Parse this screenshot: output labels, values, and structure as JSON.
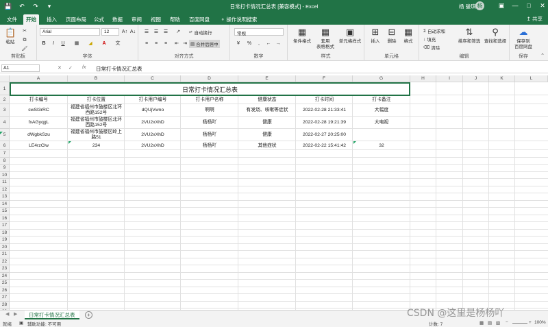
{
  "titlebar": {
    "title": "日常打卡情况汇总表 [兼容模式] - Excel",
    "user": "杨 骏琪",
    "avatar_initial": "杨"
  },
  "tabs": [
    "文件",
    "开始",
    "插入",
    "页面布局",
    "公式",
    "数据",
    "审阅",
    "视图",
    "帮助",
    "百度网盘",
    "操作说明搜索"
  ],
  "share_label": "共享",
  "ribbon": {
    "clipboard": {
      "paste": "粘贴",
      "label": "剪贴板"
    },
    "font": {
      "name": "Arial",
      "size": "12",
      "label": "字体",
      "bold": "B",
      "italic": "I",
      "underline": "U"
    },
    "alignment": {
      "wrap": "自动换行",
      "merge": "合并后居中",
      "label": "对齐方式"
    },
    "number": {
      "format": "常规",
      "label": "数字"
    },
    "styles": {
      "conditional": "条件格式",
      "table": "套用\n表格格式",
      "cell": "单元格样式",
      "label": "样式"
    },
    "cells": {
      "insert": "插入",
      "delete": "删除",
      "format": "格式",
      "label": "单元格"
    },
    "editing": {
      "autosum": "自动求和",
      "fill": "填充",
      "clear": "清除",
      "sort": "排序和筛选",
      "find": "查找和选择",
      "label": "编辑"
    },
    "save": {
      "btn": "保存到\n百度网盘",
      "label": "保存"
    }
  },
  "formula_bar": {
    "namebox": "A1",
    "fx": "fx",
    "content": "日常打卡情况汇总表"
  },
  "columns": [
    "A",
    "B",
    "C",
    "D",
    "E",
    "F",
    "G",
    "H",
    "I",
    "J",
    "K",
    "L"
  ],
  "sheet": {
    "title": "日常打卡情况汇总表",
    "headers": [
      "打卡编号",
      "打卡位置",
      "打卡用户编号",
      "打卡用户名称",
      "健康状态",
      "打卡时间",
      "打卡备注"
    ],
    "rows": [
      [
        "swSI3rRC",
        "福建省福州市鼓楼区北环西路152号",
        "dQUjVwno",
        "啊啊",
        "有发烧、咳嗽等症状",
        "2022-02-28 21:33:41",
        "大幅度"
      ],
      [
        "fxAGyqgL",
        "福建省福州市鼓楼区北环西路152号",
        "2VU2xXhD",
        "杨杨吖",
        "健康",
        "2022-02-28 19:21:39",
        "大电视"
      ],
      [
        "dWgbkSzu",
        "福建省福州市鼓楼区岭上路51",
        "2VU2xXhD",
        "杨杨吖",
        "健康",
        "2022-02-27 20:25:00",
        ""
      ],
      [
        "LE4rzClw",
        "234",
        "2VU2xXhD",
        "杨杨吖",
        "其他症状",
        "2022-02-22 15:41:42",
        "32"
      ]
    ]
  },
  "sheet_tab": "日常打卡情况汇总表",
  "status": {
    "ready": "就绪",
    "accessibility": "辅助功能: 不可用",
    "count": "计数: 7",
    "zoom": "100%"
  },
  "watermark": "CSDN @这里是杨杨吖"
}
